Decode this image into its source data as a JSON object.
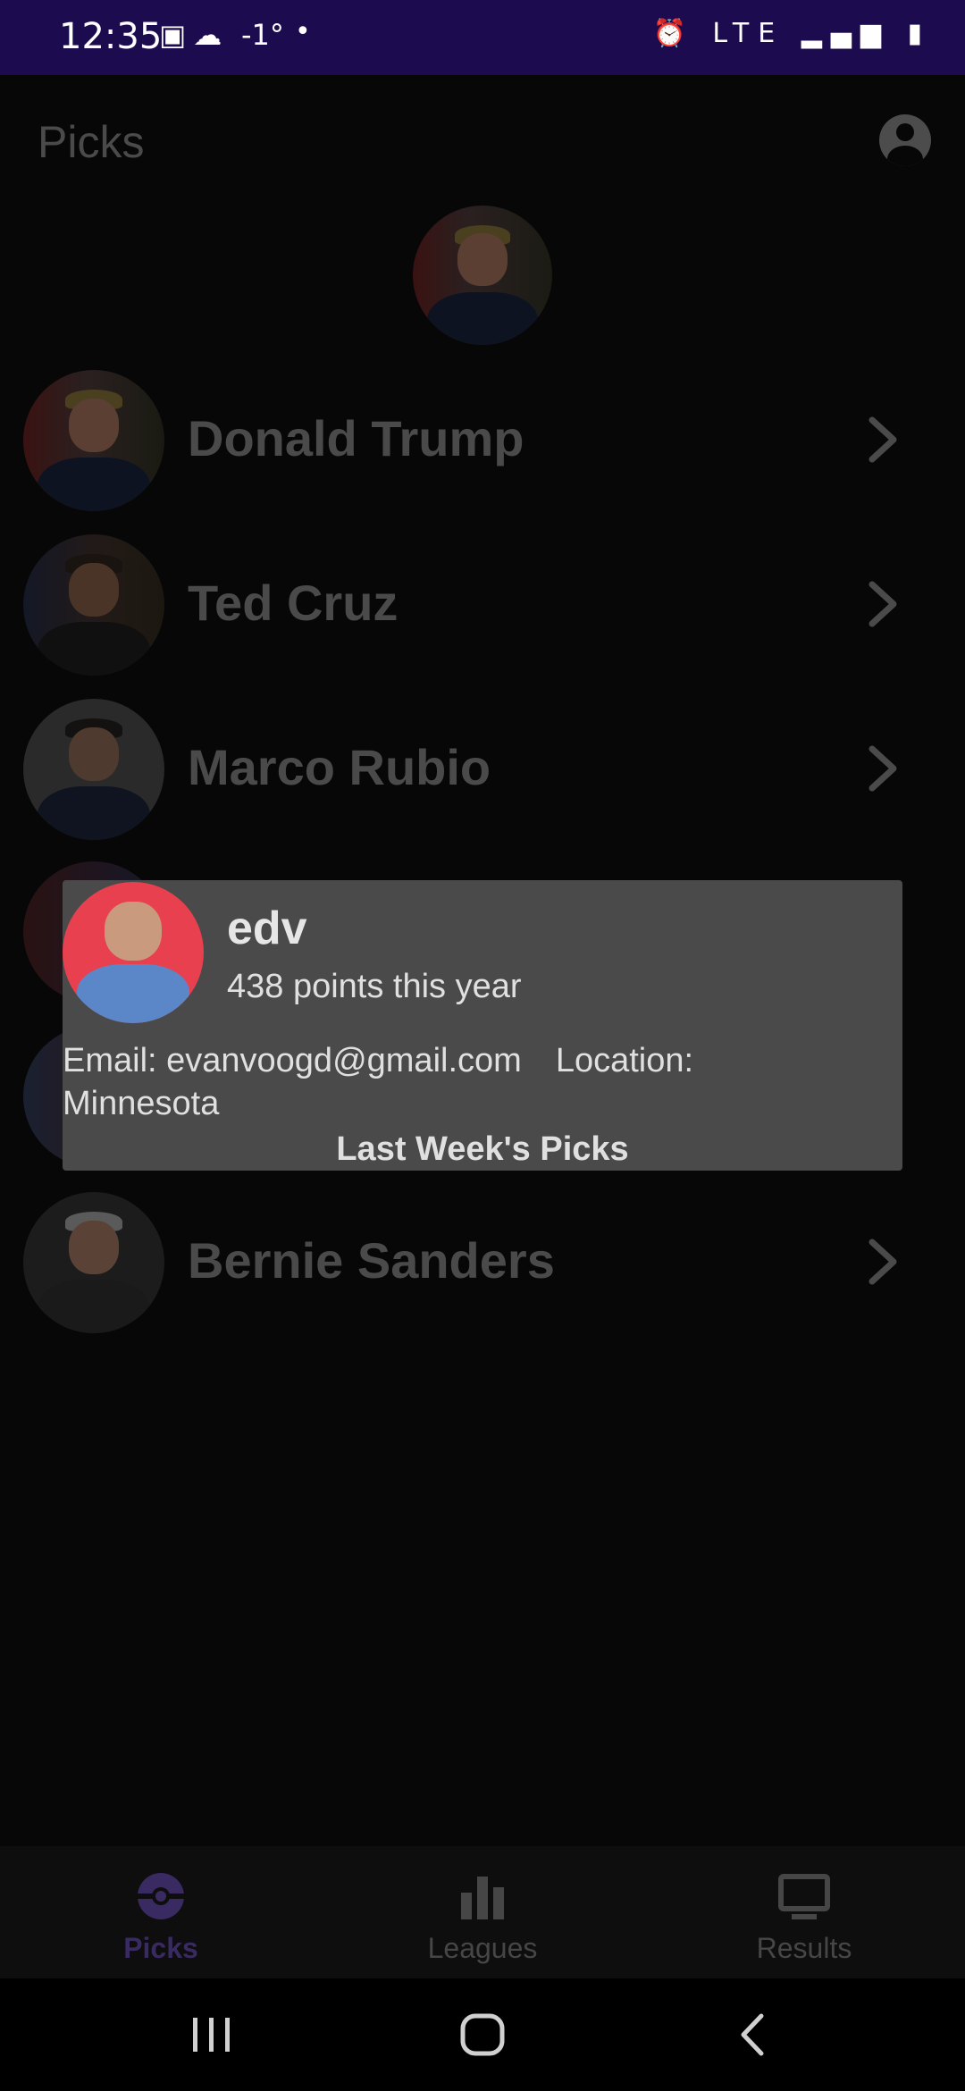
{
  "status_bar": {
    "time": "12:35",
    "temperature": "-1°",
    "dot": "•",
    "right_icons": "⏰ LTE ▂▄▆ ▮"
  },
  "app_bar": {
    "title": "Picks",
    "account_icon": "account-circle-icon"
  },
  "candidates": [
    {
      "name": "Donald Trump",
      "arrow_icon": "chevron-right-icon"
    },
    {
      "name": "Ted Cruz",
      "arrow_icon": "chevron-right-icon"
    },
    {
      "name": "Marco Rubio",
      "arrow_icon": "chevron-right-icon"
    },
    {
      "name": "Bernie Sanders",
      "arrow_icon": "chevron-right-icon"
    }
  ],
  "profile_dialog": {
    "username": "edv",
    "points": "438 points this year",
    "email_line": "Email: evanvoogd@gmail.com",
    "location_label": "Location:",
    "location_value": "Minnesota",
    "last_week_button": "Last Week's Picks"
  },
  "bottom_nav": {
    "tabs": [
      {
        "label": "Picks",
        "icon": "picks-ball-icon",
        "active": true
      },
      {
        "label": "Leagues",
        "icon": "bar-chart-icon",
        "active": false
      },
      {
        "label": "Results",
        "icon": "monitor-icon",
        "active": false
      }
    ]
  },
  "colors": {
    "status_bar_bg": "#1c0b4f",
    "accent_purple": "#3a2a62",
    "dialog_bg": "#4a4a4a",
    "scrim_bg": "#070707",
    "dialog_avatar_bg": "#e8404f"
  }
}
